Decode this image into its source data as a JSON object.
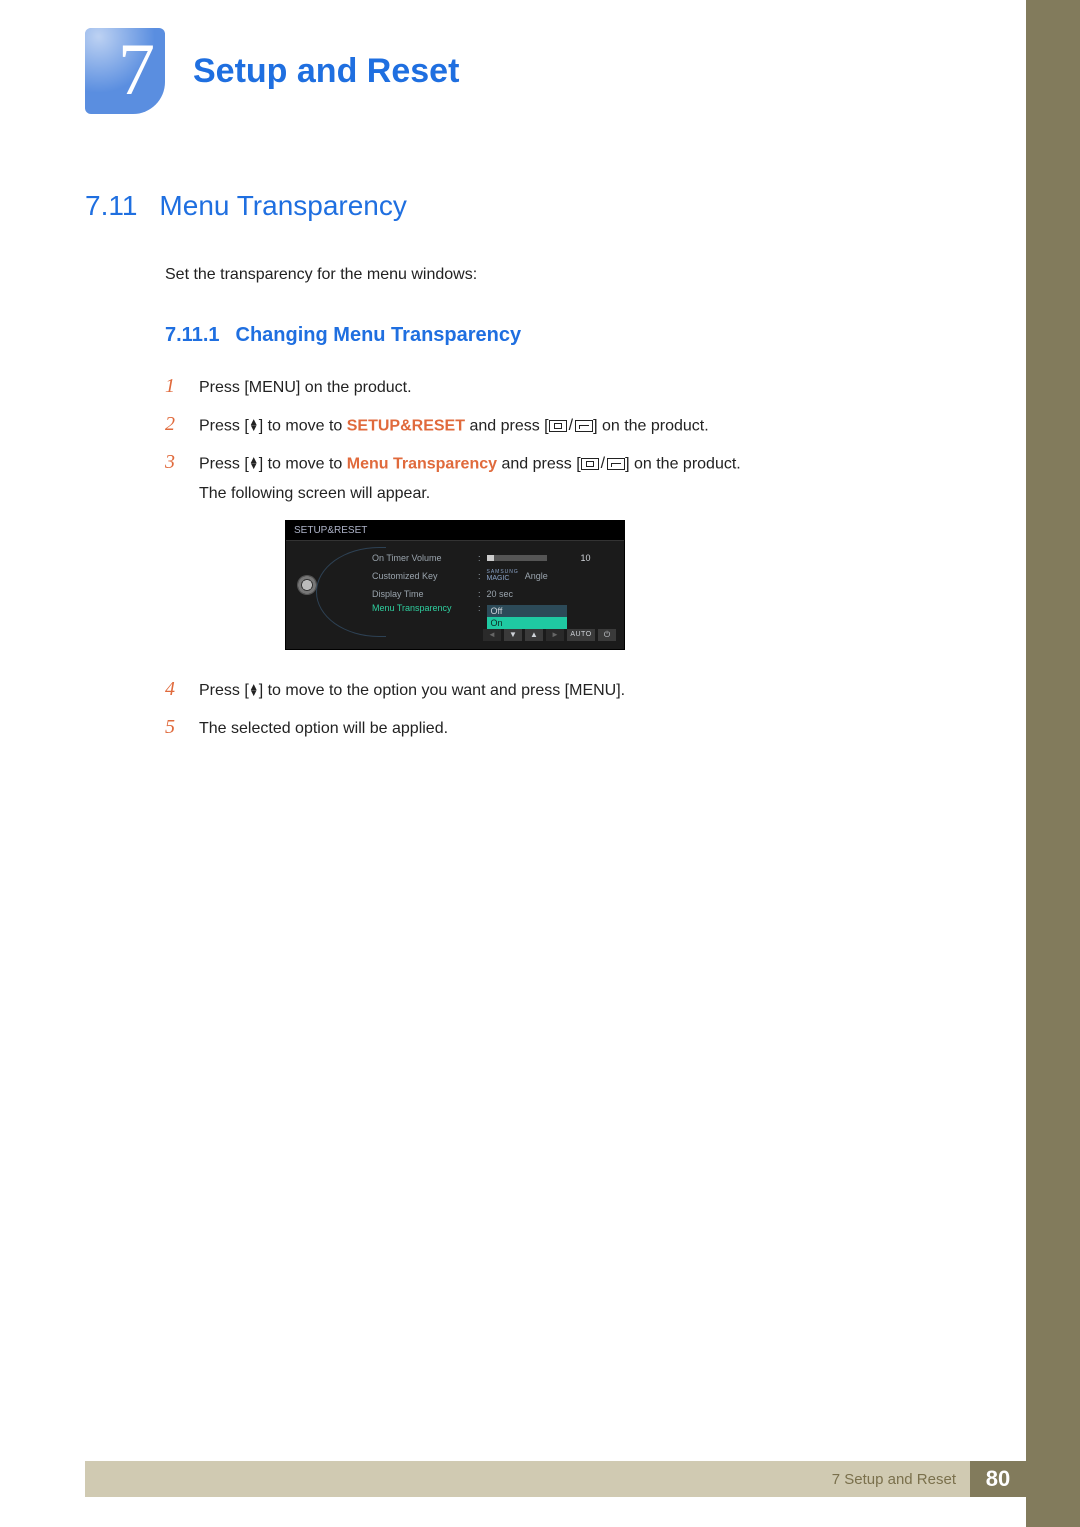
{
  "chapter": {
    "number": "7",
    "title": "Setup and Reset"
  },
  "section": {
    "number": "7.11",
    "title": "Menu Transparency"
  },
  "intro": "Set the transparency for the menu windows:",
  "subsection": {
    "number": "7.11.1",
    "title": "Changing Menu Transparency"
  },
  "steps": {
    "s1": {
      "num": "1",
      "pre": "Press [",
      "key": "MENU",
      "post": "] on the product."
    },
    "s2": {
      "num": "2",
      "a": "Press [",
      "b": "] to move to ",
      "target": "SETUP&RESET",
      "c": " and press [",
      "d": "] on the product."
    },
    "s3": {
      "num": "3",
      "a": "Press [",
      "b": "] to move to ",
      "target": "Menu Transparency",
      "c": " and press [",
      "d": "] on the product.",
      "tail": "The following screen will appear."
    },
    "s4": {
      "num": "4",
      "a": "Press [",
      "b": "] to move to the option you want and press [",
      "key": "MENU",
      "c": "]."
    },
    "s5": {
      "num": "5",
      "text": "The selected option will be applied."
    }
  },
  "osd": {
    "title": "SETUP&RESET",
    "rows": {
      "r1": {
        "label": "On Timer  Volume",
        "value": "10"
      },
      "r2": {
        "label": "Customized Key",
        "brand_top": "SAMSUNG",
        "brand_bot": "MAGIC",
        "value": "Angle"
      },
      "r3": {
        "label": "Display Time",
        "value": "20 sec"
      },
      "r4": {
        "label": "Menu Transparency",
        "opt_off": "Off",
        "opt_on": "On"
      }
    },
    "nav": {
      "auto": "AUTO"
    }
  },
  "footer": {
    "label": "7 Setup and Reset",
    "page": "80"
  }
}
